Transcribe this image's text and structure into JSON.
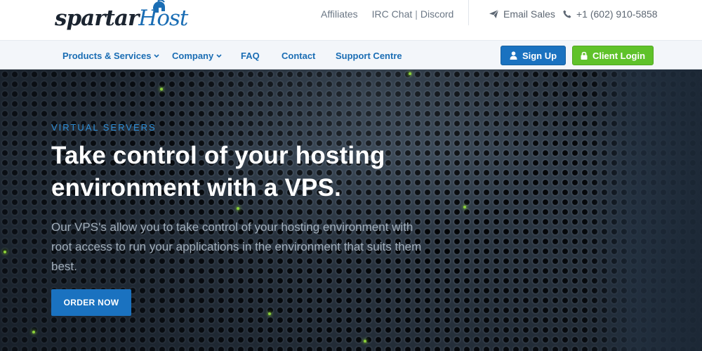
{
  "brand": {
    "logo_main": "spartar",
    "logo_accent": "Host"
  },
  "topbar": {
    "affiliates": "Affiliates",
    "irc_chat": "IRC Chat",
    "separator": "|",
    "discord": "Discord",
    "email_sales": "Email Sales",
    "phone": "+1 (602) 910-5858"
  },
  "nav": {
    "items": [
      {
        "label": "Products & Services",
        "has_dropdown": true
      },
      {
        "label": "Company",
        "has_dropdown": true
      },
      {
        "label": "FAQ",
        "has_dropdown": false
      },
      {
        "label": "Contact",
        "has_dropdown": false
      },
      {
        "label": "Support Centre",
        "has_dropdown": false
      }
    ],
    "signup_label": "Sign Up",
    "login_label": "Client Login"
  },
  "hero": {
    "kicker": "VIRTUAL SERVERS",
    "headline": "Take control of your hosting environment with a VPS.",
    "subtext": "Our VPS's allow you to take control of your hosting environment with root access to run your applications in the environment that suits them best.",
    "cta_label": "ORDER NOW"
  },
  "colors": {
    "brand_blue": "#1a72c0",
    "login_green": "#5fc22a",
    "kicker_blue": "#2f8fd8",
    "nav_background": "#f3f6fa"
  },
  "icons": {
    "email": "paper-plane-icon",
    "phone": "phone-icon",
    "signup": "user-icon",
    "login": "lock-icon",
    "dropdown": "chevron-down-icon"
  }
}
